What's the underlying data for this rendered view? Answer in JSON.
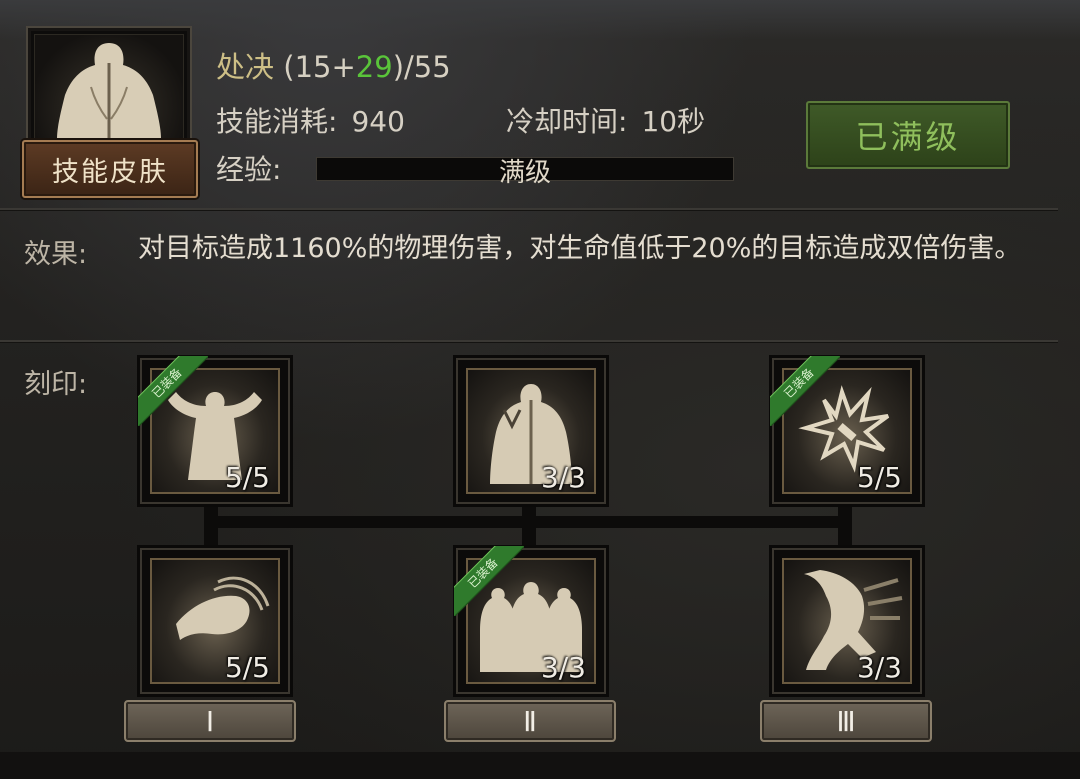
{
  "skill": {
    "name": "处决",
    "level_base": "15",
    "level_bonus": "29",
    "level_max": "55",
    "skin_button": "技能皮肤",
    "cost_label": "技能消耗:",
    "cost_value": "940",
    "cooldown_label": "冷却时间:",
    "cooldown_value": "10秒",
    "exp_label": "经验:",
    "exp_text": "满级",
    "exp_progress": 1.0,
    "max_button": "已满级"
  },
  "effect": {
    "label": "效果:",
    "text": "对目标造成1160%的物理伤害，对生命值低于20%的目标造成双倍伤害。"
  },
  "imprint": {
    "label": "刻印:",
    "nodes": [
      {
        "count": "5/5",
        "equipped": true,
        "icon": "flexing-body-icon"
      },
      {
        "count": "3/3",
        "equipped": false,
        "icon": "back-muscle-icon"
      },
      {
        "count": "5/5",
        "equipped": true,
        "icon": "burst-strike-icon"
      },
      {
        "count": "5/5",
        "equipped": false,
        "icon": "reaching-hand-icon"
      },
      {
        "count": "3/3",
        "equipped": true,
        "icon": "multiple-figures-icon"
      },
      {
        "count": "3/3",
        "equipped": false,
        "icon": "dash-figure-icon"
      }
    ],
    "ribbon_text": "已装备",
    "tiers": [
      "Ⅰ",
      "Ⅱ",
      "Ⅲ"
    ]
  },
  "colors": {
    "title": "#cdbf86",
    "bonus": "#5ac43a",
    "max_button": "#8fbf5c",
    "ribbon": "#2f7a2c"
  }
}
